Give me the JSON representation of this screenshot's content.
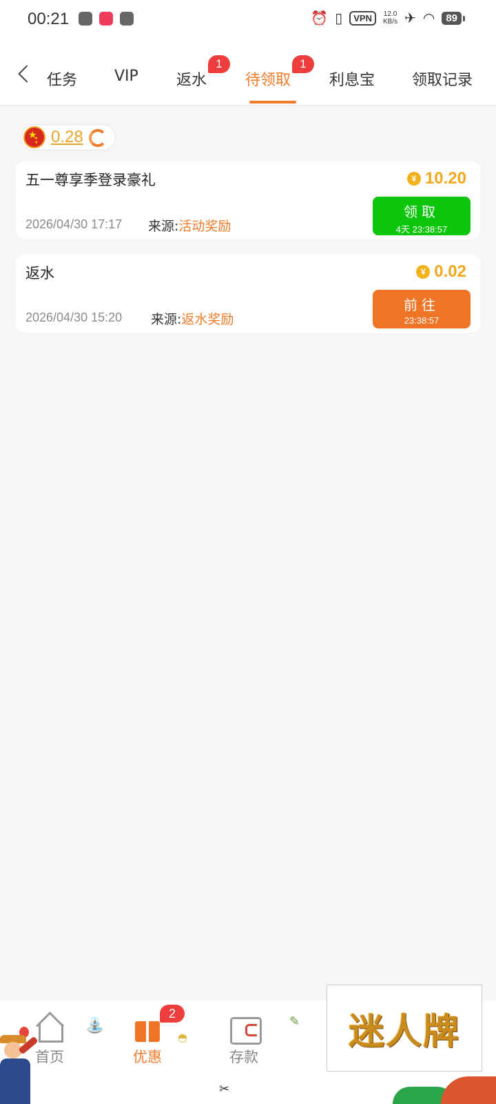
{
  "status_bar": {
    "time": "00:21",
    "vpn": "VPN",
    "speed_value": "12.0",
    "speed_unit": "KB/s",
    "battery": "89"
  },
  "tabs": [
    {
      "label": "任务",
      "active": false
    },
    {
      "label": "VIP",
      "active": false
    },
    {
      "label": "返水",
      "active": false,
      "badge": "1"
    },
    {
      "label": "待领取",
      "active": true,
      "badge": "1"
    },
    {
      "label": "利息宝",
      "active": false
    },
    {
      "label": "领取记录",
      "active": false
    }
  ],
  "balance": "0.28",
  "colors": {
    "accent": "#f07b2b",
    "amount": "#f1a81c",
    "claim_green": "#0cc60c",
    "go_orange": "#f07425",
    "badge_red": "#ee3d3d"
  },
  "rewards": [
    {
      "title": "五一尊享季登录豪礼",
      "currency_icon": "¥",
      "amount": "10.20",
      "date": "2026/04/30 17:17",
      "source_label": "来源:",
      "source": "活动奖励",
      "action_label": "领取",
      "action_time": "4天 23:38:57",
      "action_color": "green"
    },
    {
      "title": "返水",
      "currency_icon": "¥",
      "amount": "0.02",
      "date": "2026/04/30 15:20",
      "source_label": "来源:",
      "source": "返水奖励",
      "action_label": "前往",
      "action_time": "23:38:57",
      "action_color": "orange"
    }
  ],
  "bottom_nav": [
    {
      "label": "首页",
      "icon": "home-icon",
      "active": false
    },
    {
      "label": "优惠",
      "icon": "gift-icon",
      "active": true,
      "badge": "2"
    },
    {
      "label": "存款",
      "icon": "wallet-icon",
      "active": false
    }
  ],
  "watermark": "迷人牌"
}
